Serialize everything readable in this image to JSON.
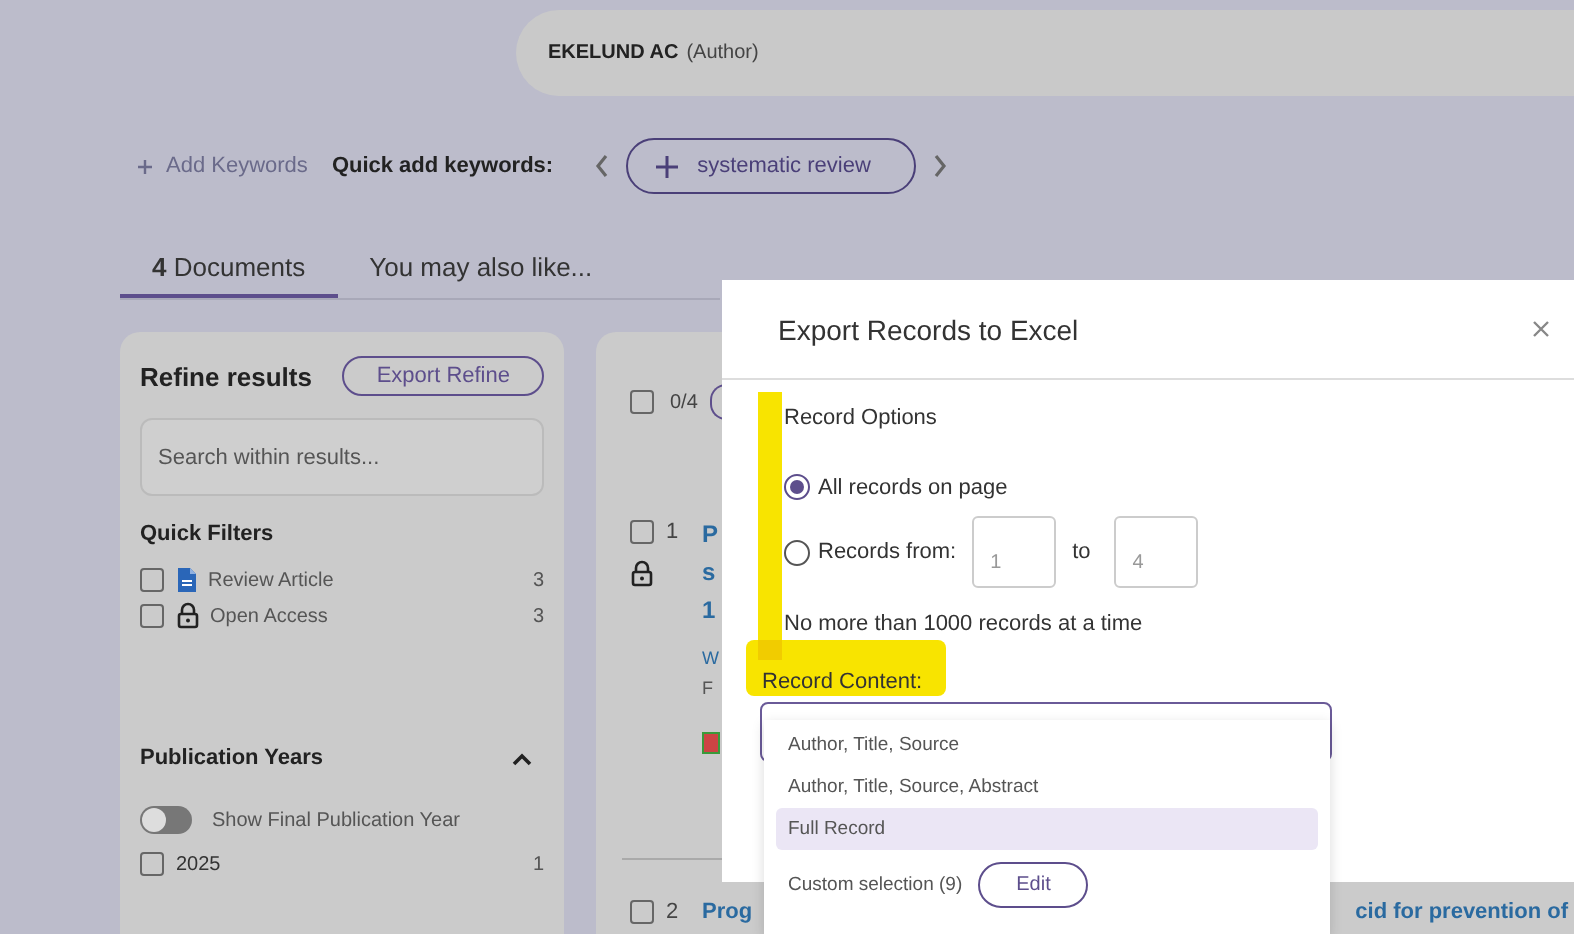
{
  "header": {
    "author_name": "EKELUND AC",
    "author_role": "(Author)"
  },
  "keywords": {
    "add_label": "Add Keywords",
    "quick_label": "Quick add keywords:",
    "chips": [
      "systematic review"
    ]
  },
  "tabs": [
    {
      "label": "**4** Documents",
      "selected": true
    },
    {
      "label": "You may also like...",
      "selected": false
    }
  ],
  "refine": {
    "title": "Refine results",
    "export_button": "Export Refine",
    "search_placeholder": "Search within results...",
    "quick_filters": {
      "title": "Quick Filters",
      "items": [
        {
          "kind": "document",
          "label": "Review Article",
          "count": "3",
          "checked": false
        },
        {
          "kind": "lock",
          "label": "Open Access",
          "count": "3",
          "checked": false
        }
      ]
    },
    "publication_years": {
      "title": "Publication Years",
      "expanded": true,
      "toggle": {
        "label": "Show Final Publication Year",
        "on": false
      },
      "items": [
        {
          "label": "2025",
          "count": "1",
          "checked": false
        }
      ]
    }
  },
  "results": {
    "select_count": "0/4",
    "select_checked": false,
    "rows": [
      {
        "number": "1",
        "checked": false,
        "locked": true,
        "title_parts": [
          "P",
          "s",
          "1"
        ],
        "meta_lines": [
          "W",
          "F"
        ]
      },
      {
        "number": "2",
        "checked": false,
        "locked": false,
        "title_parts": [
          "Prog",
          "cid for prevention of"
        ],
        "meta_lines": []
      }
    ]
  },
  "dialog": {
    "title": "Export Records to Excel",
    "record_options": {
      "title": "Record Options",
      "options": [
        {
          "kind": "all",
          "label": "All records on page",
          "selected": true
        },
        {
          "kind": "range",
          "label": "Records from:",
          "selected": false,
          "from_placeholder": "1",
          "separator": "to",
          "to_placeholder": "4"
        }
      ],
      "note": "No more than 1000 records at a time"
    },
    "record_content": {
      "label": "Record Content:",
      "options": [
        {
          "label": "Author, Title, Source",
          "selected": false
        },
        {
          "label": "Author, Title, Source, Abstract",
          "selected": false
        },
        {
          "label": "Full Record",
          "selected": true
        }
      ],
      "custom": {
        "label": "Custom selection (9)",
        "button": "Edit"
      }
    }
  }
}
